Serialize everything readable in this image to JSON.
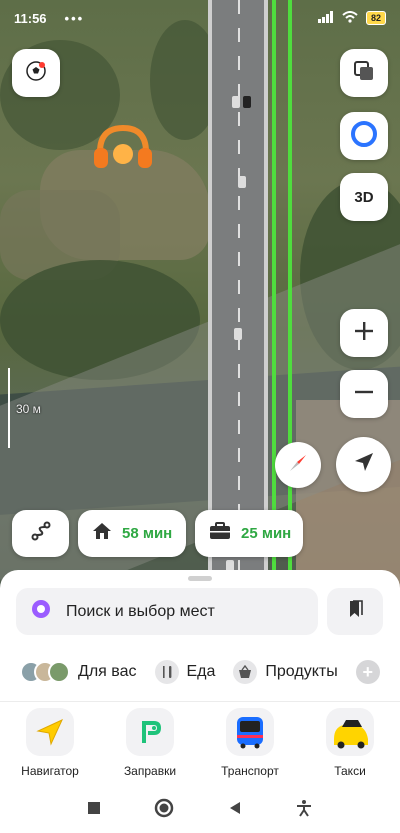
{
  "status_bar": {
    "time": "11:56",
    "dots": "•••",
    "battery": "82"
  },
  "map": {
    "scale_label": "30 м"
  },
  "map_controls": {
    "layers": "layers-icon",
    "alice": "alice-icon",
    "three_d_label": "3D",
    "zoom_in": "+",
    "zoom_out": "−"
  },
  "quick_routes": {
    "home_time": "58 мин",
    "work_time": "25 мин"
  },
  "sheet": {
    "search_placeholder": "Поиск и выбор мест",
    "categories": [
      {
        "label": "Для вас",
        "icon": "avatars-icon"
      },
      {
        "label": "Еда",
        "icon": "fork-knife-icon"
      },
      {
        "label": "Продукты",
        "icon": "basket-icon"
      }
    ],
    "apps": [
      {
        "label": "Навигатор",
        "icon": "navigator-icon"
      },
      {
        "label": "Заправки",
        "icon": "fuel-icon"
      },
      {
        "label": "Транспорт",
        "icon": "bus-icon"
      },
      {
        "label": "Такси",
        "icon": "taxi-icon"
      }
    ]
  },
  "colors": {
    "route": "#4fdd3e",
    "time_green": "#2fa843",
    "alice_blue": "#2b74ff",
    "navigator_yellow": "#ffcc00",
    "taxi_yellow": "#ffd400"
  }
}
